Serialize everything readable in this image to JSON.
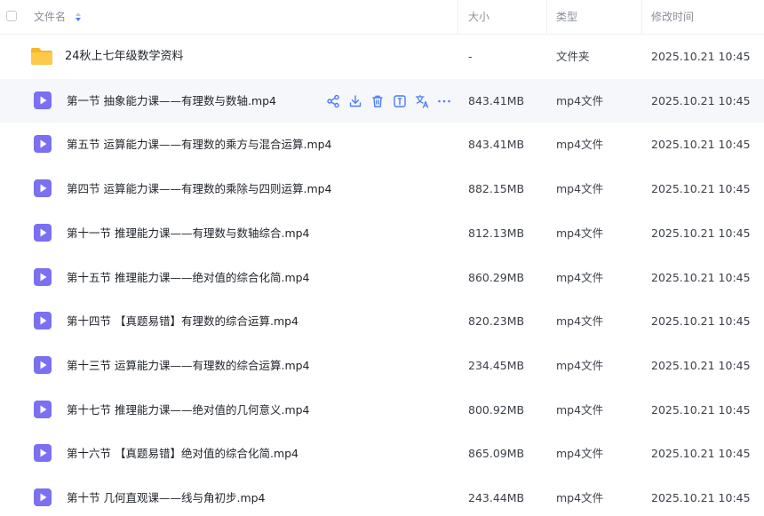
{
  "header": {
    "name_label": "文件名",
    "size_label": "大小",
    "type_label": "类型",
    "time_label": "修改时间"
  },
  "folder": {
    "name": "24秋上七年级数学资料",
    "size": "-",
    "type": "文件夹",
    "time": "2025.10.21 10:45"
  },
  "files": [
    {
      "name": "第一节 抽象能力课——有理数与数轴.mp4",
      "size": "843.41MB",
      "type": "mp4文件",
      "time": "2025.10.21 10:45"
    },
    {
      "name": "第五节 运算能力课——有理数的乘方与混合运算.mp4",
      "size": "843.41MB",
      "type": "mp4文件",
      "time": "2025.10.21 10:45"
    },
    {
      "name": "第四节 运算能力课——有理数的乘除与四则运算.mp4",
      "size": "882.15MB",
      "type": "mp4文件",
      "time": "2025.10.21 10:45"
    },
    {
      "name": "第十一节 推理能力课——有理数与数轴综合.mp4",
      "size": "812.13MB",
      "type": "mp4文件",
      "time": "2025.10.21 10:45"
    },
    {
      "name": "第十五节 推理能力课——绝对值的综合化简.mp4",
      "size": "860.29MB",
      "type": "mp4文件",
      "time": "2025.10.21 10:45"
    },
    {
      "name": "第十四节 【真题易错】有理数的综合运算.mp4",
      "size": "820.23MB",
      "type": "mp4文件",
      "time": "2025.10.21 10:45"
    },
    {
      "name": "第十三节 运算能力课——有理数的综合运算.mp4",
      "size": "234.45MB",
      "type": "mp4文件",
      "time": "2025.10.21 10:45"
    },
    {
      "name": "第十七节 推理能力课——绝对值的几何意义.mp4",
      "size": "800.92MB",
      "type": "mp4文件",
      "time": "2025.10.21 10:45"
    },
    {
      "name": "第十六节 【真题易错】绝对值的综合化简.mp4",
      "size": "865.09MB",
      "type": "mp4文件",
      "time": "2025.10.21 10:45"
    },
    {
      "name": "第十节 几何直观课——线与角初步.mp4",
      "size": "243.44MB",
      "type": "mp4文件",
      "time": "2025.10.21 10:45"
    }
  ],
  "row_actions": [
    "share-icon",
    "download-icon",
    "delete-icon",
    "info-icon",
    "translate-icon",
    "more-icon"
  ],
  "colors": {
    "accent": "#4f7cf7",
    "file_icon": "#7b6ff2",
    "folder_icon": "#ffc53d",
    "hover_row": "#f5f7fa"
  }
}
